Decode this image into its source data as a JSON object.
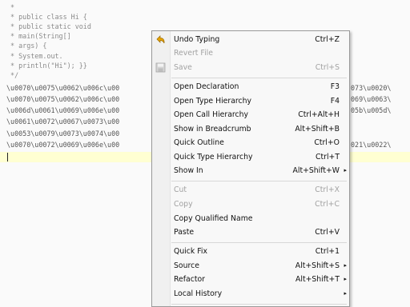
{
  "editor": {
    "lines": [
      " *",
      " * public class Hi {",
      " * public static void",
      " * main(String[]",
      " * args) {",
      " * System.out.",
      " * println(\"Hi\"); }}",
      " */",
      "\\u0070\\u0075\\u0062\\u006c\\u00",
      "\\u0070\\u0075\\u0062\\u006c\\u00",
      "\\u006d\\u0061\\u0069\\u006e\\u00",
      "\\u0061\\u0072\\u0067\\u0073\\u00",
      "\\u0053\\u0079\\u0073\\u0074\\u00",
      "\\u0070\\u0072\\u0069\\u006e\\u00"
    ],
    "right_fragments": [
      "073\\u0020\\",
      "069\\u0063\\",
      "05b\\u005d\\",
      "",
      "",
      "021\\u0022\\"
    ]
  },
  "context_menu": {
    "items": [
      {
        "label": "Undo Typing",
        "shortcut": "Ctrl+Z",
        "icon": "undo-icon"
      },
      {
        "label": "Revert File",
        "shortcut": "",
        "disabled": true
      },
      {
        "label": "Save",
        "shortcut": "Ctrl+S",
        "disabled": true,
        "icon": "save-icon"
      },
      {
        "label": "Open Declaration",
        "shortcut": "F3"
      },
      {
        "label": "Open Type Hierarchy",
        "shortcut": "F4"
      },
      {
        "label": "Open Call Hierarchy",
        "shortcut": "Ctrl+Alt+H"
      },
      {
        "label": "Show in Breadcrumb",
        "shortcut": "Alt+Shift+B"
      },
      {
        "label": "Quick Outline",
        "shortcut": "Ctrl+O"
      },
      {
        "label": "Quick Type Hierarchy",
        "shortcut": "Ctrl+T"
      },
      {
        "label": "Show In",
        "shortcut": "Alt+Shift+W",
        "submenu": true
      },
      {
        "label": "Cut",
        "shortcut": "Ctrl+X",
        "disabled": true
      },
      {
        "label": "Copy",
        "shortcut": "Ctrl+C",
        "disabled": true
      },
      {
        "label": "Copy Qualified Name",
        "shortcut": ""
      },
      {
        "label": "Paste",
        "shortcut": "Ctrl+V"
      },
      {
        "label": "Quick Fix",
        "shortcut": "Ctrl+1"
      },
      {
        "label": "Source",
        "shortcut": "Alt+Shift+S",
        "submenu": true
      },
      {
        "label": "Refactor",
        "shortcut": "Alt+Shift+T",
        "submenu": true
      },
      {
        "label": "Local History",
        "shortcut": "",
        "submenu": true
      }
    ],
    "submenu_arrow": "▸"
  },
  "colors": {
    "current_line": "#ffffd2",
    "disabled_text": "#a2a2a2"
  }
}
